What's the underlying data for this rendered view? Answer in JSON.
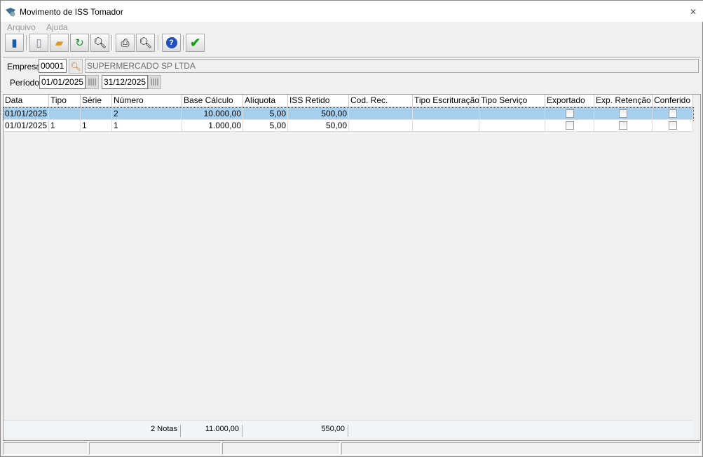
{
  "window": {
    "title": "Movimento de ISS Tomador",
    "close": "✕"
  },
  "menu": [
    "Arquivo",
    "Ajuda"
  ],
  "toolbar": [
    "exit",
    "new",
    "open",
    "refresh",
    "search",
    "print",
    "preview",
    "help",
    "confirm"
  ],
  "filters": {
    "empresa_label": "Empresa",
    "empresa_code": "00001",
    "empresa_name": "SUPERMERCADO SP LTDA",
    "periodo_label": "Período",
    "date_from": "01/01/2025",
    "date_to": "31/12/2025"
  },
  "table": {
    "columns": [
      "Data",
      "Tipo",
      "Série",
      "Número",
      "Base Cálculo",
      "Alíquota",
      "ISS Retido",
      "Cod. Rec.",
      "Tipo Escrituração",
      "Tipo Serviço",
      "Exportado",
      "Exp. Retenção",
      "Conferido"
    ],
    "rows": [
      {
        "data": "01/01/2025",
        "tipo": "",
        "serie": "",
        "numero": "2",
        "base": "10.000,00",
        "aliquota": "5,00",
        "iss": "500,00",
        "cod": "",
        "esc": "",
        "serv": "",
        "exportado": false,
        "exp_ret": false,
        "conferido": false
      },
      {
        "data": "01/01/2025",
        "tipo": "1",
        "serie": "1",
        "numero": "1",
        "base": "1.000,00",
        "aliquota": "5,00",
        "iss": "50,00",
        "cod": "",
        "esc": "",
        "serv": "",
        "exportado": false,
        "exp_ret": false,
        "conferido": false
      }
    ],
    "footer": {
      "count": "2 Notas",
      "base_total": "11.000,00",
      "iss_total": "550,00"
    }
  },
  "colors": {
    "selection": "#a6d0ee"
  }
}
